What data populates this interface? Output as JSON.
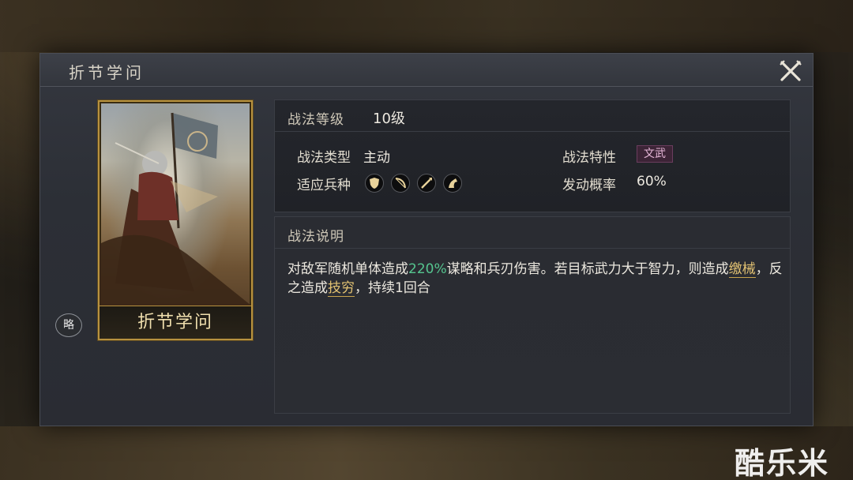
{
  "panel": {
    "title": "折节学问",
    "close_icon": "close-crossed-swords-icon"
  },
  "card": {
    "name": "折节学问",
    "badge_text": "略"
  },
  "info": {
    "level_label": "战法等级",
    "level_value": "10级",
    "type_label": "战法类型",
    "type_value": "主动",
    "trait_label": "战法特性",
    "trait_value": "文武",
    "unit_label": "适应兵种",
    "unit_icons": [
      "shield-icon",
      "bow-icon",
      "spear-icon",
      "horse-icon"
    ],
    "rate_label": "发动概率",
    "rate_value": "60%"
  },
  "description": {
    "label": "战法说明",
    "part1": "对敌军随机单体造成",
    "pct": "220%",
    "part2": "谋略和兵刃伤害。若目标武力大于智力，则造成",
    "status1": "缴械",
    "part3": "，反之造成",
    "status2": "技穷",
    "part4": "，持续1回合"
  },
  "colors": {
    "highlight_green": "#55c58f",
    "status_gold": "#e2c272",
    "card_border": "#b8923f",
    "trait_tag": "#e8b7d9"
  },
  "watermark": "酷乐米"
}
